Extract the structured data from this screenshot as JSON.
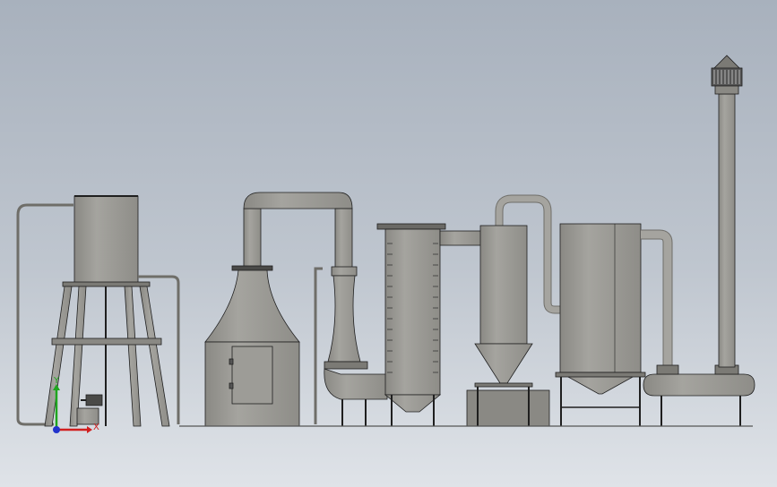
{
  "triad": {
    "x_label": "X",
    "y_label": "Y",
    "x_color": "#d11f1f",
    "y_color": "#1fa51f",
    "z_color": "#2233cc"
  },
  "colors": {
    "equipment": "#989792",
    "equipment_light": "#b3b2ad",
    "equipment_dark": "#7b7a75",
    "outline": "#1f1f1f",
    "pipe": "#8d8c87",
    "background_top": "#a8b1bd",
    "background_bottom": "#dfe3e8"
  }
}
